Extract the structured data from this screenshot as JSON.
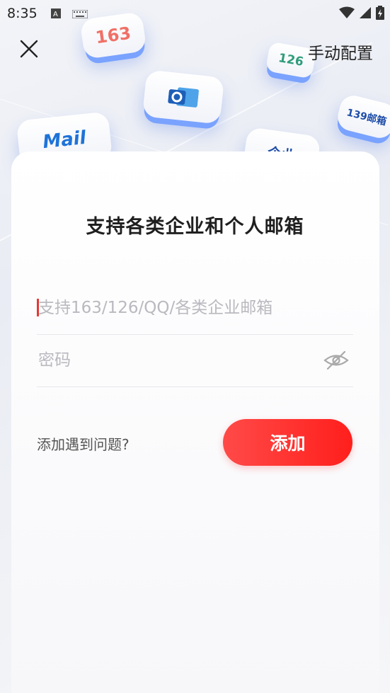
{
  "status_bar": {
    "time": "8:35"
  },
  "header": {
    "manual_config_label": "手动配置"
  },
  "tiles": {
    "t163": "163",
    "t126": "126",
    "t139": "139邮箱",
    "tmail": "Mail",
    "tcorp": "企业"
  },
  "main": {
    "title": "支持各类企业和个人邮箱",
    "email_placeholder": "支持163/126/QQ/各类企业邮箱",
    "password_placeholder": "密码",
    "help_label": "添加遇到问题?",
    "add_button_label": "添加"
  },
  "colors": {
    "accent": "#ff2a27",
    "caret": "#e53935",
    "tile_shadow": "#7aa2ff"
  }
}
